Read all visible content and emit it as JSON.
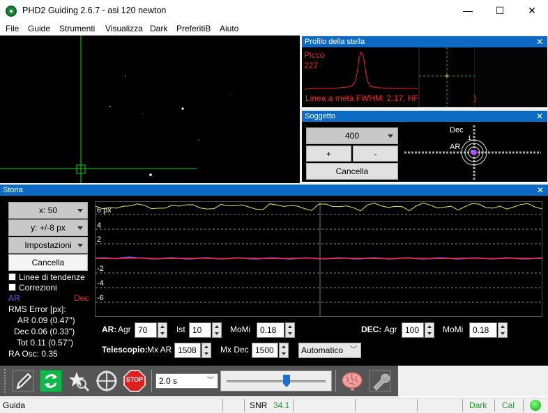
{
  "window": {
    "title": "PHD2 Guiding 2.6.7 - asi 120 newton",
    "minimize": "—",
    "maximize": "☐",
    "close": "✕"
  },
  "menu": [
    "File",
    "Guide",
    "Strumenti",
    "Visualizza",
    "Dark",
    "PreferitiB",
    "Aiuto"
  ],
  "profile": {
    "title": "Profilo della stella",
    "peak_label": "Picco",
    "peak_value": "227",
    "fwhm_text": "Linea a metà FWHM: 2.17, HF",
    "fwhm_tail": ")"
  },
  "target": {
    "title": "Soggetto",
    "scale_value": "400",
    "plus": "+",
    "minus": "-",
    "clear": "Cancella",
    "dec_label": "Dec",
    "ra_label": "AR",
    "dec_tick": "1"
  },
  "history": {
    "title": "Storia",
    "x_scale": "x:  50",
    "y_scale": "y: +/-8 px",
    "settings": "Impostazioni",
    "clear": "Cancella",
    "trend_lines": "Linee di tendenze",
    "corrections": "Correzioni",
    "legend_ra": "AR",
    "legend_dec": "Dec",
    "rms_title": "RMS Error [px]:",
    "rms_ra": "AR 0.09 (0.47'')",
    "rms_dec": "Dec 0.06 (0.33'')",
    "rms_tot": "Tot 0.11 (0.57'')",
    "ra_osc": "RA Osc: 0.35",
    "y_labels": [
      "6 px",
      "4",
      "2",
      "-2",
      "-4",
      "-6"
    ],
    "colors": {
      "ra": "#6060ff",
      "dec": "#ff2020",
      "snr": "#e8e84a"
    }
  },
  "controls": {
    "ar_label": "AR:",
    "agr_label": "Agr",
    "ar_agr": "70",
    "ist_label": "Ist",
    "ar_ist": "10",
    "momi_label": "MoMi",
    "ar_momi": "0.18",
    "dec_label": "DEC:",
    "dec_agr_label": "Agr",
    "dec_agr": "100",
    "dec_momi_label": "MoMi",
    "dec_momi": "0.18",
    "scope_label": "Telescopio:",
    "mxar_label": "Mx AR",
    "mx_ar": "1508",
    "mxdec_label": "Mx Dec",
    "mx_dec": "1500",
    "dec_mode": "Automatico"
  },
  "toolbar": {
    "exposure": "2.0 s",
    "stop": "STOP"
  },
  "status": {
    "mode": "Guida",
    "snr_label": "SNR",
    "snr_value": "34.1",
    "dark": "Dark",
    "cal": "Cal"
  }
}
